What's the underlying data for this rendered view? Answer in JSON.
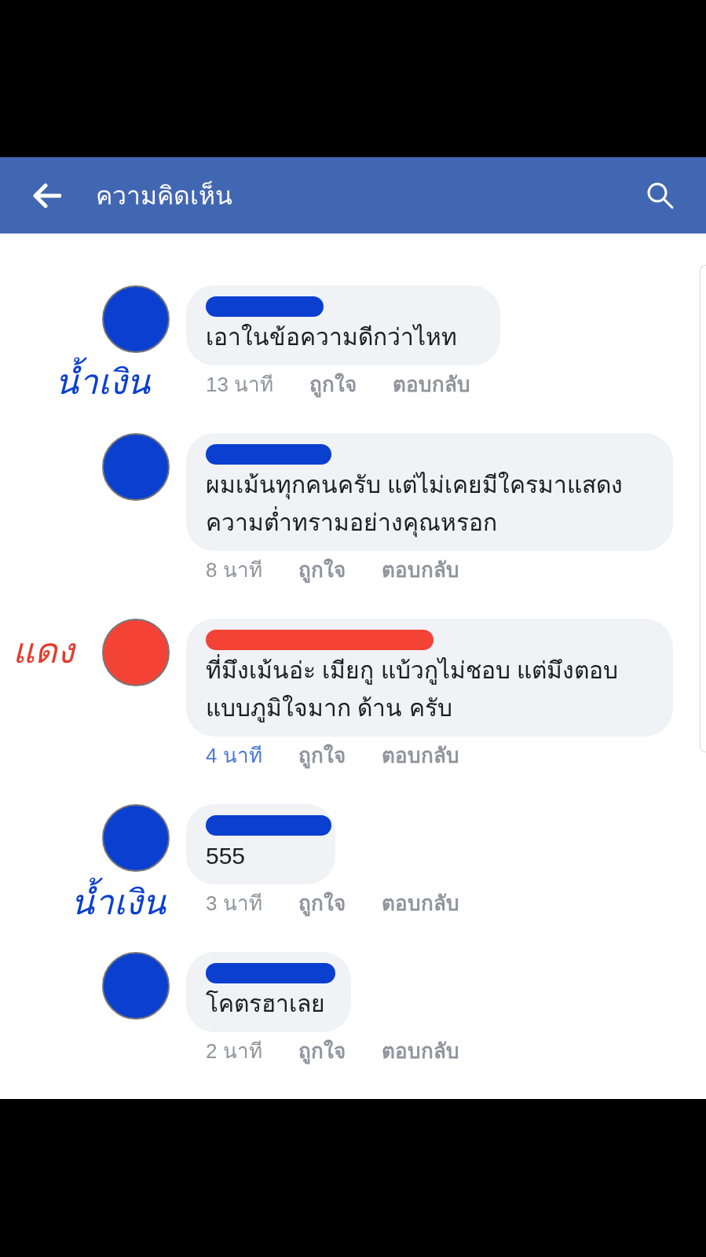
{
  "header": {
    "title": "ความคิดเห็น"
  },
  "comments": [
    {
      "color": "#0a3fd0",
      "text": "เอาในข้อความดีกว่าไหท",
      "time": "13 นาที",
      "time_highlighted": false,
      "like": "ถูกใจ",
      "reply": "ตอบกลับ",
      "annotation": {
        "text": "น้ำเงิน",
        "color": "#0a3fd0"
      }
    },
    {
      "color": "#0a3fd0",
      "text": "ผมเม้นทุกคนครับ แต่ไม่เคยมีใครมาแสดงความต่ำทรามอย่างคุณหรอก",
      "time": "8 นาที",
      "time_highlighted": false,
      "like": "ถูกใจ",
      "reply": "ตอบกลับ"
    },
    {
      "color": "#f44336",
      "text": "ที่มึงเม้นอ่ะ เมียกู แบ้วกูไม่ชอบ แต่มึงตอบแบบภูมิใจมาก ด้าน ครับ",
      "time": "4 นาที",
      "time_highlighted": true,
      "like": "ถูกใจ",
      "reply": "ตอบกลับ",
      "annotation": {
        "text": "แดง",
        "color": "#e53a2c"
      }
    },
    {
      "color": "#0a3fd0",
      "text": "555",
      "time": "3 นาที",
      "time_highlighted": false,
      "like": "ถูกใจ",
      "reply": "ตอบกลับ",
      "annotation": {
        "text": "น้ำเงิน",
        "color": "#0a3fd0"
      }
    },
    {
      "color": "#0a3fd0",
      "text": "โคตรฮาเลย",
      "time": "2 นาที",
      "time_highlighted": false,
      "like": "ถูกใจ",
      "reply": "ตอบกลับ"
    }
  ]
}
